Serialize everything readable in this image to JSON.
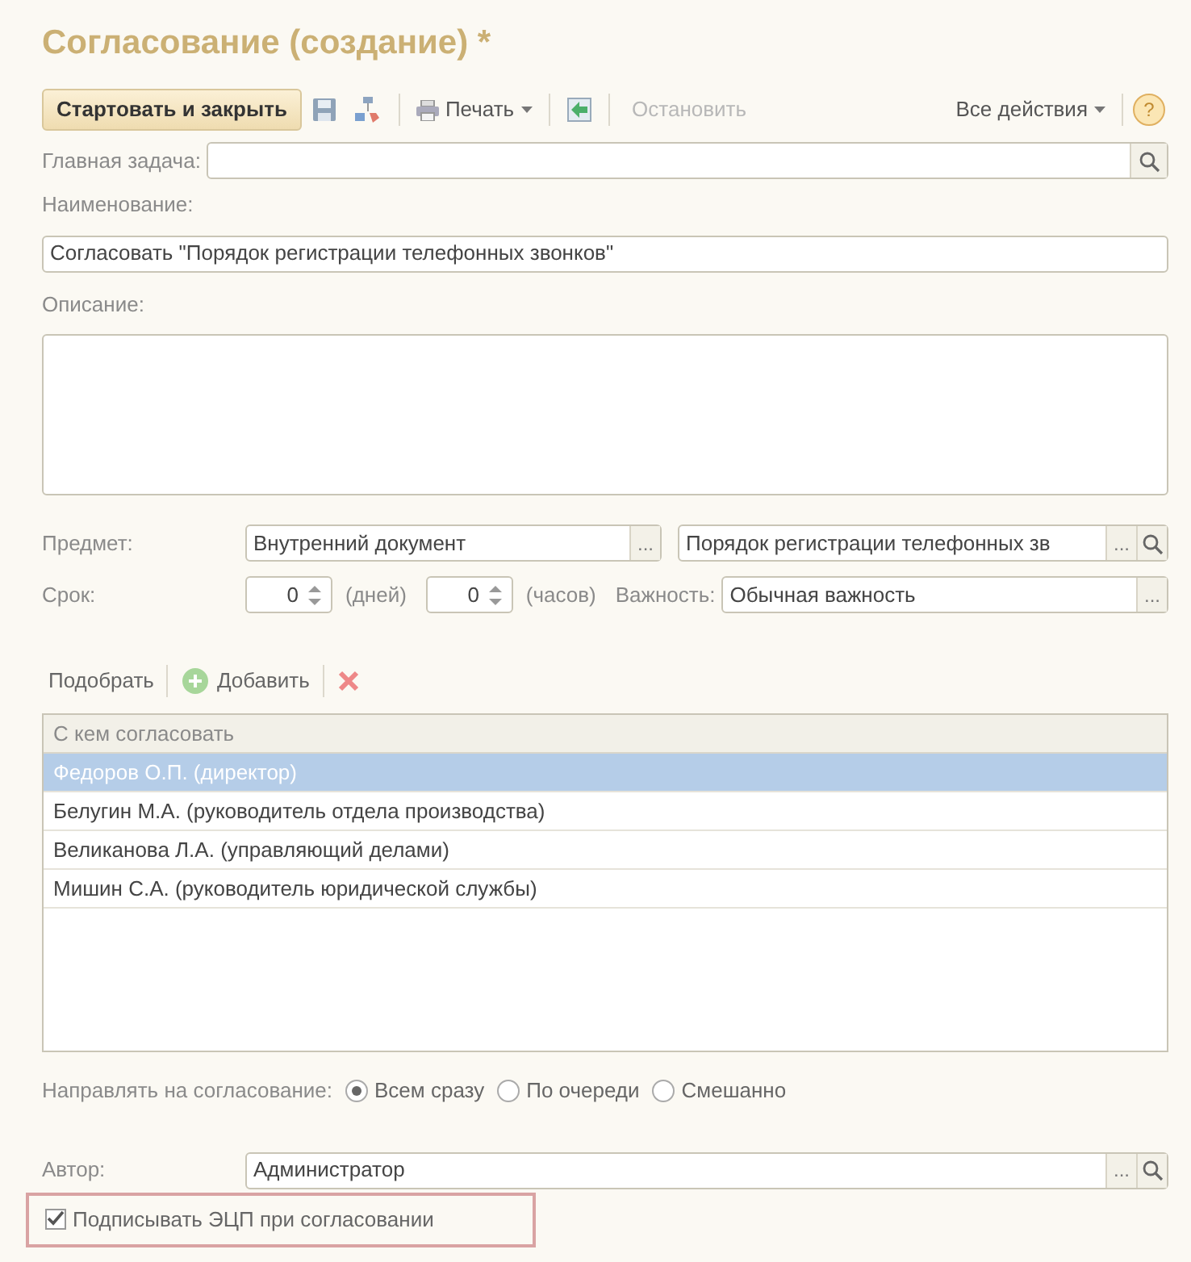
{
  "window": {
    "title": "Согласование (создание) *"
  },
  "toolbar": [
    {
      "kind": "primary",
      "label": "Стартовать и закрыть"
    },
    {
      "kind": "save"
    },
    {
      "kind": "route"
    },
    {
      "kind": "separator"
    },
    {
      "kind": "printmenu",
      "label": "Печать"
    },
    {
      "kind": "separator"
    },
    {
      "kind": "arrow"
    },
    {
      "kind": "separator"
    },
    {
      "kind": "text",
      "label": "Остановить",
      "disabled": true
    },
    {
      "kind": "spacer"
    },
    {
      "kind": "menu",
      "label": "Все действия"
    },
    {
      "kind": "separator"
    },
    {
      "kind": "help",
      "label": "?"
    }
  ],
  "main_task": {
    "label": "Главная задача:"
  },
  "name": {
    "label": "Наименование:",
    "value": "Согласовать \"Порядок регистрации телефонных звонков\""
  },
  "description": {
    "label": "Описание:"
  },
  "subject": {
    "label": "Предмет:",
    "type_value": "Внутренний документ",
    "value": "Порядок регистрации телефонных зв",
    "ellipsis": "..."
  },
  "deadline": {
    "label": "Срок:",
    "days": "0",
    "days_unit": "(дней)",
    "hours": "0",
    "hours_unit": "(часов)",
    "importance_label": "Важность:",
    "importance": "Обычная важность",
    "ellipsis": "..."
  },
  "table_toolbar": {
    "pick": "Подобрать",
    "add": "Добавить"
  },
  "table": {
    "columns": [
      "С кем согласовать"
    ],
    "rows": [
      {
        "cells": [
          "Федоров О.П. (директор)"
        ],
        "selected": true
      },
      {
        "cells": [
          "Белугин М.А. (руководитель отдела производства)"
        ],
        "selected": false
      },
      {
        "cells": [
          "Великанова Л.А. (управляющий делами)"
        ],
        "selected": false
      },
      {
        "cells": [
          "Мишин С.А. (руководитель юридической службы)"
        ],
        "selected": false
      }
    ]
  },
  "routing": {
    "label": "Направлять на согласование:",
    "options": [
      {
        "label": "Всем сразу",
        "selected": true
      },
      {
        "label": "По очереди",
        "selected": false
      },
      {
        "label": "Смешанно",
        "selected": false
      }
    ]
  },
  "author": {
    "label": "Автор:",
    "value": "Администратор",
    "ellipsis": "..."
  },
  "sign": {
    "label": "Подписывать ЭЦП при согласовании",
    "checked": true
  }
}
